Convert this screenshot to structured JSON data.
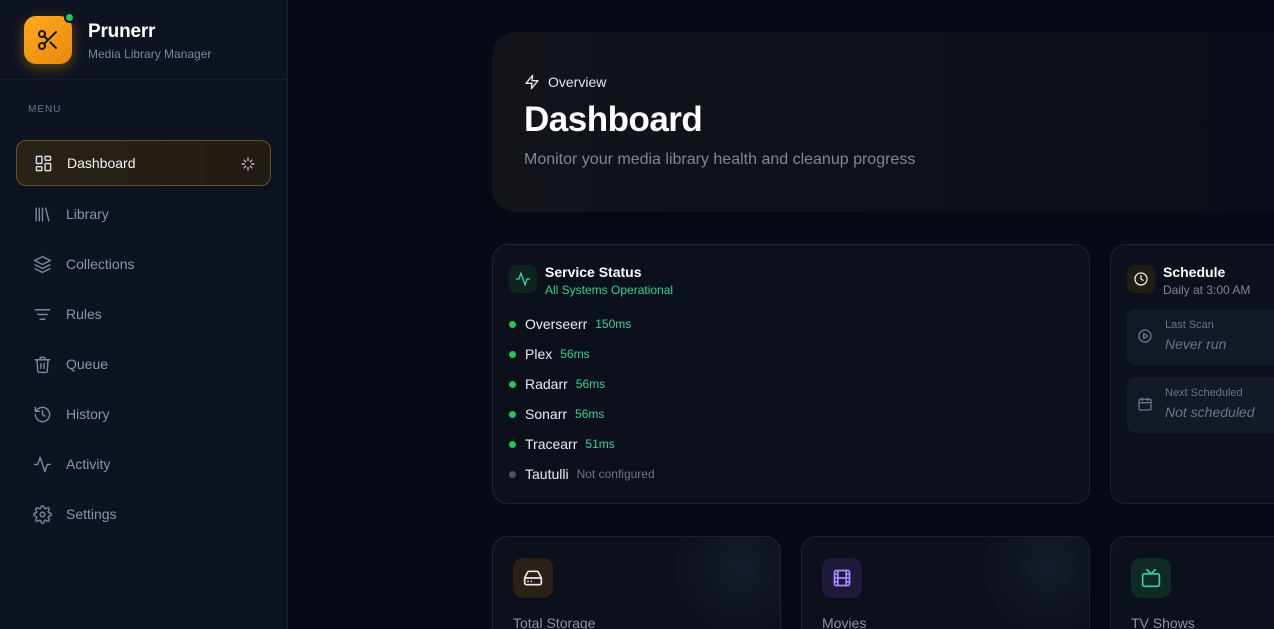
{
  "brand": {
    "name": "Prunerr",
    "subtitle": "Media Library Manager",
    "accent": "#f59e0b",
    "status_color": "#22c55e"
  },
  "sidebar": {
    "menu_label": "MENU",
    "items": [
      {
        "label": "Dashboard",
        "icon": "dashboard-grid-icon",
        "active": true
      },
      {
        "label": "Library",
        "icon": "library-icon"
      },
      {
        "label": "Collections",
        "icon": "layers-icon"
      },
      {
        "label": "Rules",
        "icon": "filter-icon"
      },
      {
        "label": "Queue",
        "icon": "trash-icon"
      },
      {
        "label": "History",
        "icon": "history-icon"
      },
      {
        "label": "Activity",
        "icon": "activity-icon"
      },
      {
        "label": "Settings",
        "icon": "gear-icon"
      }
    ]
  },
  "hero": {
    "eyebrow": "Overview",
    "title": "Dashboard",
    "subtitle": "Monitor your media library health and cleanup progress"
  },
  "service_status": {
    "title": "Service Status",
    "subtitle": "All Systems Operational",
    "services": [
      {
        "name": "Overseerr",
        "latency": "150ms",
        "online": true
      },
      {
        "name": "Plex",
        "latency": "56ms",
        "online": true
      },
      {
        "name": "Radarr",
        "latency": "56ms",
        "online": true
      },
      {
        "name": "Sonarr",
        "latency": "56ms",
        "online": true
      },
      {
        "name": "Tracearr",
        "latency": "51ms",
        "online": true
      },
      {
        "name": "Tautulli",
        "latency": "Not configured",
        "online": false
      }
    ]
  },
  "schedule": {
    "title": "Schedule",
    "subtitle": "Daily at 3:00 AM",
    "last_scan_label": "Last Scan",
    "last_scan_value": "Never run",
    "next_label": "Next Scheduled",
    "next_value": "Not scheduled"
  },
  "stats": [
    {
      "label": "Total Storage",
      "icon": "hard-drive-icon",
      "color": "#f59e0b"
    },
    {
      "label": "Movies",
      "icon": "film-icon",
      "color": "#8b5cf6"
    },
    {
      "label": "TV Shows",
      "icon": "tv-icon",
      "color": "#10b981"
    }
  ]
}
